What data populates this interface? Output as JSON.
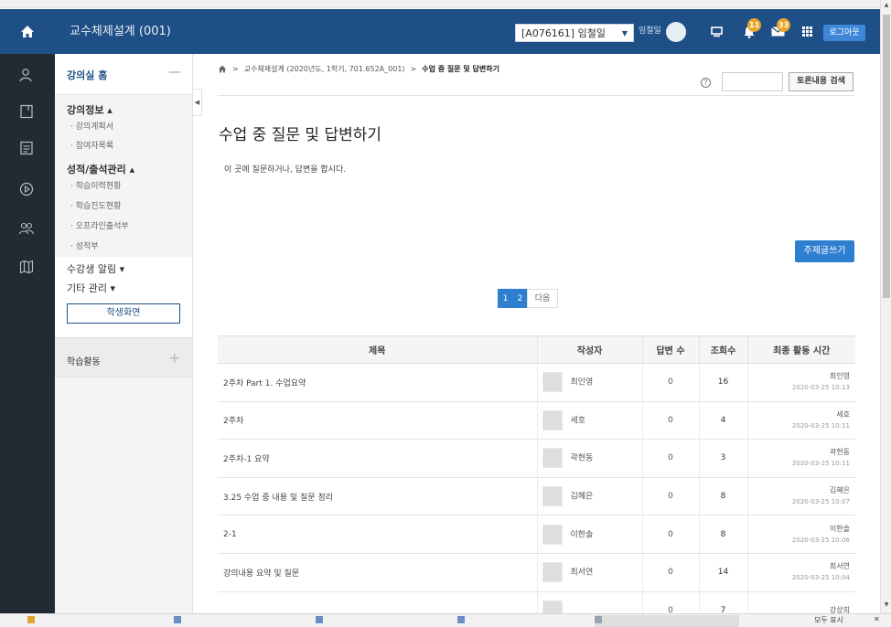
{
  "header": {
    "course_title": "교수체제설계 (001)",
    "user_select": "[A076161] 임철일",
    "user_name": "임철일",
    "notification_count": "11",
    "message_count": "33",
    "logout": "로그아웃"
  },
  "menu": {
    "home": "강의실 홈",
    "sections": [
      {
        "label": "강의정보 ▴",
        "items": [
          "· 강의계획서",
          "· 참여자목록"
        ]
      },
      {
        "label": "성적/출석관리 ▴",
        "items": [
          "· 학습이력현황",
          "· 학습진도현황",
          "· 오프라인출석부",
          "· 성적부"
        ]
      }
    ],
    "notice": "수강생 알림 ▾",
    "other": "기타 관리 ▾",
    "student_view": "학생화면",
    "activities": "학습활동"
  },
  "breadcrumb": {
    "course": "교수체제설계 (2020년도, 1학기, 701.652A_001)",
    "current": "수업 중 질문 및 답변하기"
  },
  "search": {
    "placeholder": "",
    "button": "토론내용 검색"
  },
  "page": {
    "title": "수업 중 질문 및 답변하기",
    "description": "이 곳에 질문하거나, 답변을 합시다.",
    "new_topic": "주제글쓰기"
  },
  "pagination": {
    "pages": [
      "1",
      "2"
    ],
    "next": "다음"
  },
  "table": {
    "headers": [
      "제목",
      "작성자",
      "답변 수",
      "조회수",
      "최종 활동 시간"
    ],
    "rows": [
      {
        "title": "2주차 Part 1. 수업요약",
        "author": "최인영",
        "replies": "0",
        "views": "16",
        "last_user": "최인영",
        "last_time": "2020-03-25 10:13"
      },
      {
        "title": "2주차",
        "author": "세호",
        "replies": "0",
        "views": "4",
        "last_user": "세호",
        "last_time": "2020-03-25 10:11"
      },
      {
        "title": "2주차-1 요약",
        "author": "곽현동",
        "replies": "0",
        "views": "3",
        "last_user": "곽현동",
        "last_time": "2020-03-25 10:11"
      },
      {
        "title": "3.25 수업 중 내용 및 질문 정리",
        "author": "김혜은",
        "replies": "0",
        "views": "8",
        "last_user": "김혜은",
        "last_time": "2020-03-25 10:07"
      },
      {
        "title": "2-1",
        "author": "이한솔",
        "replies": "0",
        "views": "8",
        "last_user": "이한솔",
        "last_time": "2020-03-25 10:06"
      },
      {
        "title": "강의내용 요약 및 질문",
        "author": "최서연",
        "replies": "0",
        "views": "14",
        "last_user": "최서연",
        "last_time": "2020-03-25 10:04"
      },
      {
        "title": "",
        "author": "",
        "replies": "0",
        "views": "7",
        "last_user": "강상희",
        "last_time": ""
      }
    ]
  },
  "taskbar": {
    "right": "모두 표시"
  },
  "colors": {
    "header": "#1e4f86",
    "rail": "#222a33",
    "primary_button": "#2f7fd1",
    "badge": "#e9a62b"
  }
}
